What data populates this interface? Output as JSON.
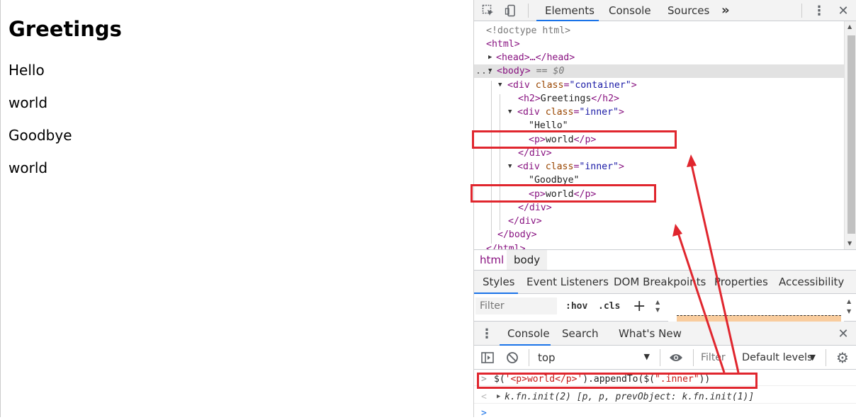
{
  "page": {
    "heading": "Greetings",
    "paragraphs": [
      "Hello",
      "world",
      "Goodbye",
      "world"
    ]
  },
  "devtools": {
    "top_tabs": [
      "Elements",
      "Console",
      "Sources"
    ],
    "more_tabs_glyph": "»",
    "tree": {
      "doctype": "<!doctype html>",
      "html_open": "<html>",
      "head_collapsed": "<head>…</head>",
      "body_open": "<body>",
      "body_eq": "== $0",
      "dots": "...",
      "container_div": {
        "tag": "div",
        "attr": "class",
        "value": "\"container\""
      },
      "h2": {
        "tag": "h2",
        "text": "Greetings"
      },
      "inner_div": {
        "tag": "div",
        "attr": "class",
        "value": "\"inner\""
      },
      "text_hello": "\"Hello\"",
      "p_world": {
        "tag": "p",
        "text": "world"
      },
      "close_div": "</div>",
      "text_goodbye": "\"Goodbye\"",
      "close_body": "</body>",
      "close_html": "</html>"
    },
    "breadcrumbs": [
      "html",
      "body"
    ],
    "panel_tabs": [
      "Styles",
      "Event Listeners",
      "DOM Breakpoints",
      "Properties",
      "Accessibility"
    ],
    "styles": {
      "filter_placeholder": "Filter",
      "hov": ":hov",
      "cls": ".cls",
      "add": "+"
    },
    "drawer_tabs": [
      "Console",
      "Search",
      "What's New"
    ],
    "console_toolbar": {
      "context": "top",
      "filter_placeholder": "Filter",
      "levels": "Default levels"
    },
    "console": {
      "input": "$('<p>world</p>').appendTo($(\".inner\"))",
      "input_prefix": "$(",
      "input_string": "'<p>world</p>'",
      "input_mid": ").appendTo($(",
      "input_string2": "\".inner\"",
      "input_end": "))",
      "result": "k.fn.init(2) [p, p, prevObject: k.fn.init(1)]",
      "prompt": ">",
      "result_prefix": "<"
    }
  }
}
